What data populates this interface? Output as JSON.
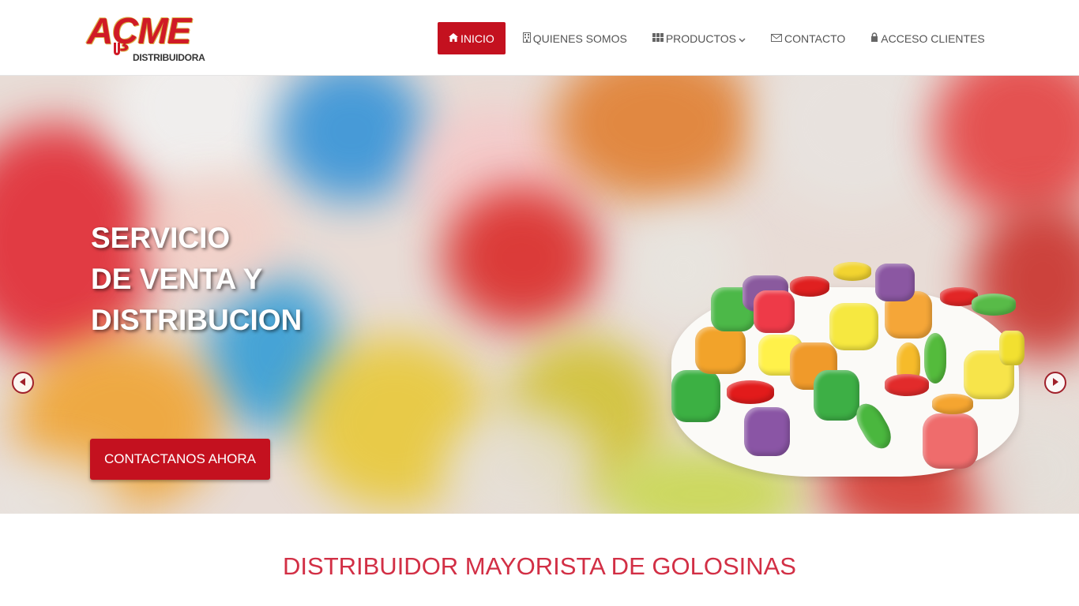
{
  "brand": {
    "logo_text": "AÇME",
    "logo_subtitle": "DISTRIBUIDORA",
    "accent_color": "#c4111f"
  },
  "nav": {
    "items": [
      {
        "label": "INICIO",
        "icon": "home-icon",
        "active": true
      },
      {
        "label": "QUIENES SOMOS",
        "icon": "building-icon",
        "active": false
      },
      {
        "label": "PRODUCTOS",
        "icon": "grid-icon",
        "active": false,
        "dropdown": true
      },
      {
        "label": "CONTACTO",
        "icon": "envelope-icon",
        "active": false
      },
      {
        "label": "ACCESO CLIENTES",
        "icon": "lock-icon",
        "active": false
      }
    ]
  },
  "hero": {
    "title_lines": [
      "SERVICIO",
      "DE VENTA Y",
      "DISTRIBUCION"
    ],
    "cta_label": "CONTACTANOS AHORA",
    "slides_count": 3,
    "active_slide": 2
  },
  "section": {
    "title": "DISTRIBUIDOR MAYORISTA DE GOLOSINAS"
  }
}
